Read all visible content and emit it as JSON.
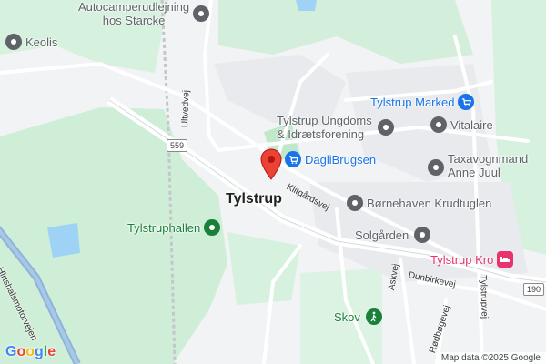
{
  "town_label": "Tylstrup",
  "pois": {
    "autocamper": {
      "line1": "Autocamperudlejning",
      "line2": "hos Starcke",
      "color": "#5f6368"
    },
    "keolis": {
      "line1": "Keolis",
      "color": "#5f6368"
    },
    "tylstrup_marked": {
      "line1": "Tylstrup Marked",
      "color": "#1a73e8"
    },
    "ungdoms": {
      "line1": "Tylstrup Ungdoms",
      "line2": "& Idrætsforening",
      "color": "#5f6368"
    },
    "vitalaire": {
      "line1": "Vitalaire",
      "color": "#5f6368"
    },
    "daglibrugsen": {
      "line1": "DagliBrugsen",
      "color": "#1a73e8"
    },
    "taxa": {
      "line1": "Taxavognmand",
      "line2": "Anne Juul",
      "color": "#5f6368"
    },
    "bornehaven": {
      "line1": "Børnehaven Krudtuglen",
      "color": "#5f6368"
    },
    "tylstruphallen": {
      "line1": "Tylstruphallen",
      "color": "#188038"
    },
    "solgarden": {
      "line1": "Solgården",
      "color": "#5f6368"
    },
    "kro": {
      "line1": "Tylstrup Kro",
      "color": "#e8336d"
    },
    "skov": {
      "line1": "Skov",
      "color": "#188038"
    }
  },
  "roads": {
    "ultvedvej": "Ultvedvej",
    "klitgardsvej": "Klitgårdsvej",
    "askvej": "Askvej",
    "dunbirkevej": "Dunbirkevej",
    "rodbogevej": "Rødbøgevej",
    "tylstrupvej": "Tylstrupvej",
    "motorvej": "Hirtshalsmotorvejen"
  },
  "shields": {
    "r559": "559",
    "r190": "190"
  },
  "logo": "Google",
  "attribution": "Map data ©2025 Google",
  "colors": {
    "land": "#f1f3f4",
    "park": "#cfeed7",
    "water": "#9fd3f5",
    "road": "#ffffff",
    "motorway": "#8fb4d9",
    "pin": "#ea4335"
  }
}
